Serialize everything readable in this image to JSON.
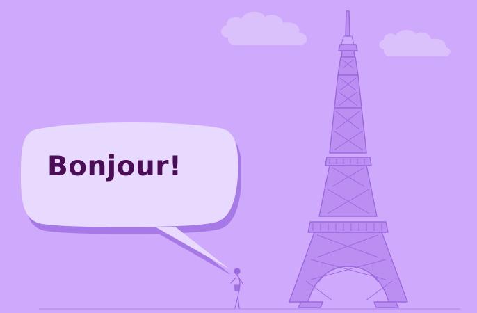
{
  "scene": {
    "speech_bubble": {
      "text": "Bonjour!"
    },
    "illustration": {
      "landmark": "eiffel-tower",
      "figure": "person",
      "clouds": 2
    },
    "colors": {
      "background": "#cfa9fb",
      "cloud": "#dcc3fb",
      "bubble_fill": "#e7d9ff",
      "bubble_shadow": "#a779e6",
      "tower_fill": "#bb8ff2",
      "tower_line": "#9b68df",
      "text": "#4b0d55"
    }
  }
}
